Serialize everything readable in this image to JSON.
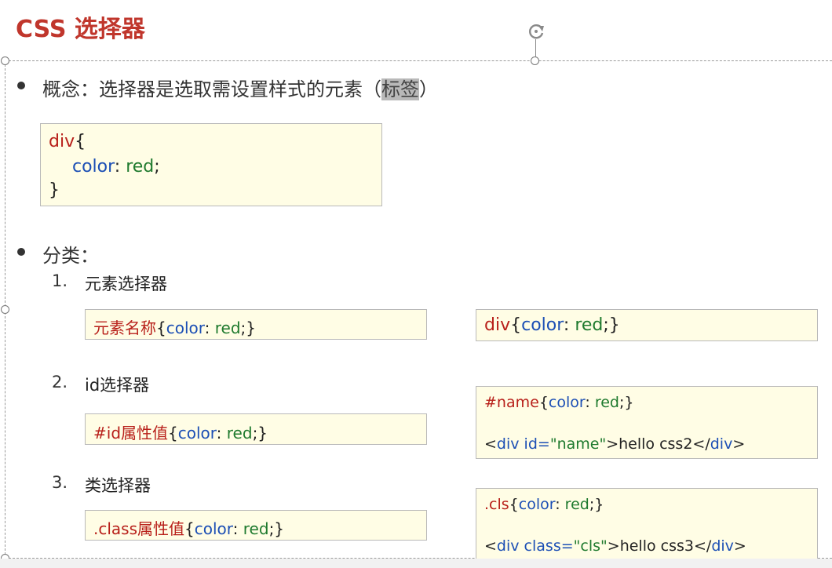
{
  "slide": {
    "title": "CSS 选择器",
    "concept": {
      "prefix": "概念：选择器是选取需设置样式的元素（",
      "highlight": "标签",
      "suffix": "）"
    },
    "example": {
      "line1_sel": "div",
      "line1_brace": "{",
      "line2_prop": "color",
      "line2_colon": ": ",
      "line2_val": "red",
      "line2_semi": ";",
      "line3": "}"
    },
    "category_label": "分类：",
    "items": [
      {
        "num": "1.",
        "label": "元素选择器",
        "syntax": {
          "sel": "元素名称",
          "open": "{",
          "prop": "color",
          "colon": ": ",
          "val": "red",
          "close": ";}"
        },
        "demo": {
          "sel": "div",
          "open": "{",
          "prop": "color",
          "colon": ": ",
          "val": "red",
          "close": ";}"
        }
      },
      {
        "num": "2.",
        "label": "id选择器",
        "syntax": {
          "sel": "#id属性值",
          "open": "{",
          "prop": "color",
          "colon": ": ",
          "val": "red",
          "close": ";}"
        },
        "demo": {
          "sel": "#name",
          "open": "{",
          "prop": "color",
          "colon": ": ",
          "val": "red",
          "close": ";}",
          "html_lt": "<",
          "html_tag": "div",
          "html_attr": " id=",
          "html_attrval": "\"name\"",
          "html_gt": ">",
          "html_text": "hello css2",
          "html_closelt": "</",
          "html_closetag": "div",
          "html_closegt": ">"
        }
      },
      {
        "num": "3.",
        "label": "类选择器",
        "syntax": {
          "sel": ".class属性值",
          "open": "{",
          "prop": "color",
          "colon": ": ",
          "val": "red",
          "close": ";}"
        },
        "demo": {
          "sel": ".cls",
          "open": "{",
          "prop": "color",
          "colon": ": ",
          "val": "red",
          "close": ";}",
          "html_lt": "<",
          "html_tag": "div",
          "html_attr": " class=",
          "html_attrval": "\"cls\"",
          "html_gt": ">",
          "html_text": "hello css3",
          "html_closelt": "</",
          "html_closetag": "div",
          "html_closegt": ">"
        }
      }
    ],
    "colors": {
      "title": "#c0362c",
      "selector": "#b8201a",
      "property": "#1c4fb5",
      "value": "#1f7a2e",
      "box_background": "#fffde5",
      "highlight": "#b9b9b9"
    },
    "icons": [
      "bullet-dot-icon",
      "rotate-handle-icon",
      "resize-handle-icon"
    ]
  }
}
